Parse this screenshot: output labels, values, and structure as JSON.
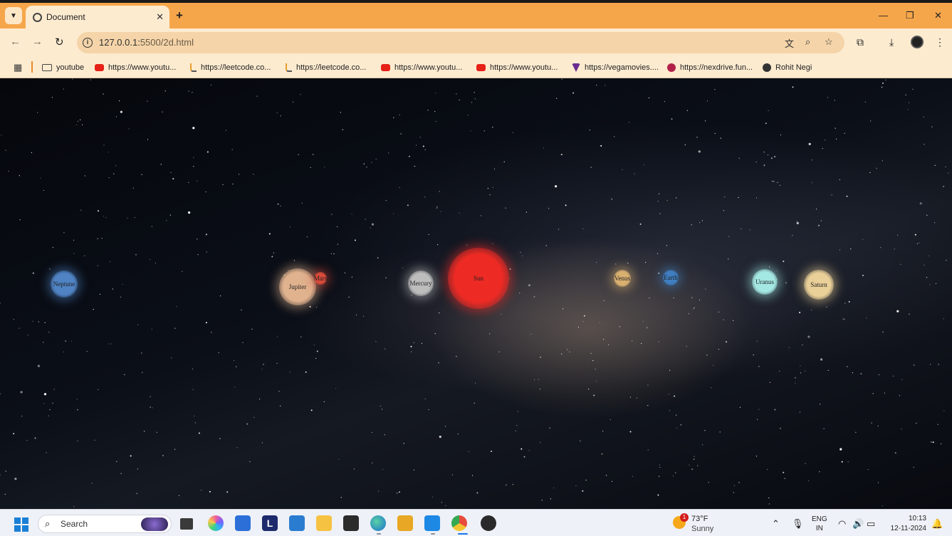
{
  "browser": {
    "tab": {
      "title": "Document"
    },
    "address": {
      "host": "127.0.0.1:",
      "path": "5500/2d.html"
    },
    "bookmarks": [
      {
        "label": "youtube",
        "icon": "folder-icon"
      },
      {
        "label": "https://www.youtu...",
        "icon": "youtube-icon"
      },
      {
        "label": "https://leetcode.co...",
        "icon": "leetcode-icon"
      },
      {
        "label": "https://leetcode.co...",
        "icon": "leetcode-icon"
      },
      {
        "label": "https://www.youtu...",
        "icon": "youtube-icon"
      },
      {
        "label": "https://www.youtu...",
        "icon": "youtube-icon"
      },
      {
        "label": "https://vegamovies....",
        "icon": "vegamovies-icon"
      },
      {
        "label": "https://nexdrive.fun...",
        "icon": "nexdrive-icon"
      },
      {
        "label": "Rohit Negi",
        "icon": "globe-icon"
      }
    ]
  },
  "page": {
    "planets": [
      {
        "name": "Neptune",
        "color": "#4f83c4"
      },
      {
        "name": "Jupiter",
        "color": "#e0b28e"
      },
      {
        "name": "Mars",
        "color": "#d94a3a"
      },
      {
        "name": "Mercury",
        "color": "#bdbdbd"
      },
      {
        "name": "Sun",
        "color": "#ee2a24"
      },
      {
        "name": "Venus",
        "color": "#d9b070"
      },
      {
        "name": "Earth",
        "color": "#3f7ec0"
      },
      {
        "name": "Uranus",
        "color": "#a4e8e4"
      },
      {
        "name": "Saturn",
        "color": "#e9cf98"
      }
    ]
  },
  "taskbar": {
    "search_label": "Search",
    "weather": {
      "badge": "1",
      "temp": "73°F",
      "condition": "Sunny"
    },
    "lang": {
      "line1": "ENG",
      "line2": "IN"
    },
    "clock": {
      "time": "10:13",
      "date": "12-11-2024"
    }
  }
}
